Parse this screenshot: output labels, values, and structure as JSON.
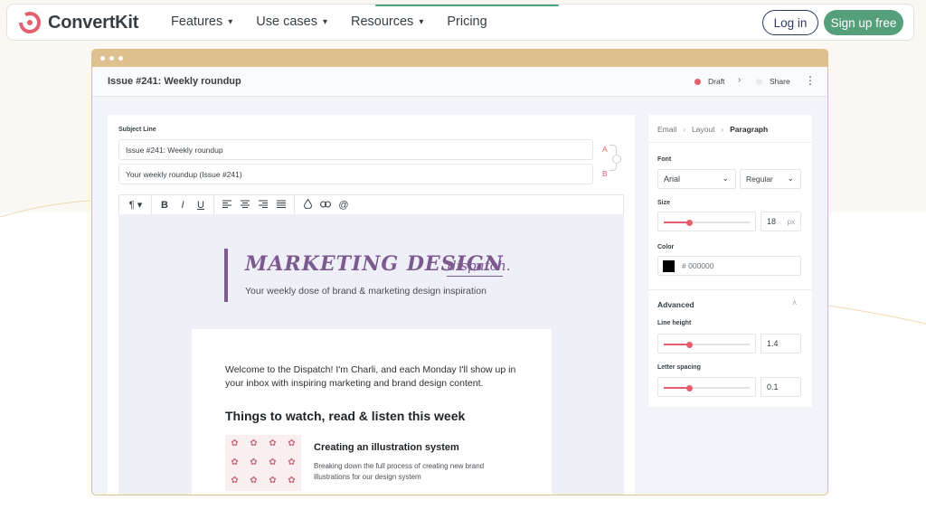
{
  "nav": {
    "brand": "ConvertKit",
    "items": [
      {
        "label": "Features",
        "has_dropdown": true
      },
      {
        "label": "Use cases",
        "has_dropdown": true
      },
      {
        "label": "Resources",
        "has_dropdown": true
      },
      {
        "label": "Pricing",
        "has_dropdown": false
      }
    ],
    "login_label": "Log in",
    "signup_label": "Sign up free"
  },
  "app": {
    "issue_title": "Issue #241: Weekly roundup",
    "status_draft": "Draft",
    "status_share": "Share"
  },
  "editor": {
    "subject_label": "Subject Line",
    "subject_a": "Issue #241: Weekly roundup",
    "subject_b": "Your weekly roundup (Issue #241)",
    "variant_a": "A",
    "variant_b": "B",
    "toolbar_icons": [
      "paragraph-icon",
      "bold-icon",
      "italic-icon",
      "underline-icon",
      "align-left-icon",
      "align-center-icon",
      "align-right-icon",
      "align-justify-icon",
      "color-drop-icon",
      "link-icon",
      "mention-icon"
    ]
  },
  "email": {
    "hero_title": "MARKETING DESIGN",
    "hero_script": "dispatch.",
    "hero_subtitle": "Your weekly dose of brand & marketing design inspiration",
    "welcome": "Welcome to the Dispatch! I'm Charli, and each Monday I'll show up in your inbox with inspiring marketing and brand design content.",
    "section_heading": "Things to watch, read & listen this week",
    "article_title": "Creating an illustration system",
    "article_desc": "Breaking down the full process of creating new brand illustrations for our design system"
  },
  "settings": {
    "breadcrumb": [
      "Email",
      "Layout",
      "Paragraph"
    ],
    "font_label": "Font",
    "font_family": "Arial",
    "font_weight": "Regular",
    "size_label": "Size",
    "size_value": "18",
    "size_unit": "px",
    "size_slider": 0.3,
    "color_label": "Color",
    "color_value": "# 000000",
    "advanced_label": "Advanced",
    "line_height_label": "Line height",
    "line_height_value": "1.4",
    "line_height_slider": 0.3,
    "letter_spacing_label": "Letter spacing",
    "letter_spacing_value": "0.1",
    "letter_spacing_slider": 0.3
  },
  "colors": {
    "accent": "#e4606d",
    "brand_green": "#55a07b",
    "window_bar": "#dfc08f",
    "email_purple": "#7c5a8f"
  }
}
